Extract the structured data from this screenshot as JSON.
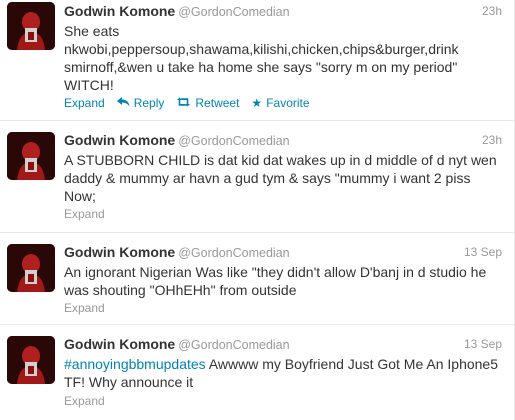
{
  "tweets": [
    {
      "name": "Godwin Komone",
      "handle": "@GordonComedian",
      "time": "23h",
      "text_plain": "She eats\nnkwobi,peppersoup,shawama,kilishi,chicken,chips&burger,drink\nsmirnoff,&wen u take ha home she says \"sorry m on my period\"\nWITCH!",
      "actions": {
        "expand": "Expand",
        "reply": "Reply",
        "retweet": "Retweet",
        "favorite": "Favorite"
      }
    },
    {
      "name": "Godwin Komone",
      "handle": "@GordonComedian",
      "time": "23h",
      "text_plain": "A STUBBORN CHILD is dat kid dat wakes up in d middle of d nyt wen\ndaddy & mummy ar havn a gud tym & says \"mummy i want 2 piss\nNow;",
      "actions": {
        "expand": "Expand"
      }
    },
    {
      "name": "Godwin Komone",
      "handle": "@GordonComedian",
      "time": "13 Sep",
      "text_plain": "An ignorant Nigerian Was like \"they didn't allow D'banj in d studio he\nwas shouting \"OHhEHh\" from outside",
      "actions": {
        "expand": "Expand"
      }
    },
    {
      "name": "Godwin Komone",
      "handle": "@GordonComedian",
      "time": "13 Sep",
      "hashtag": "#annoyingbbmupdates",
      "text_after_hashtag": " Awwww my Boyfriend Just Got Me An Iphone5\nTF! Why announce it",
      "actions": {
        "expand": "Expand"
      }
    }
  ],
  "colors": {
    "link": "#0084b4",
    "muted": "#999999",
    "text": "#333333",
    "divider": "#e8e8e8"
  },
  "icons": {
    "reply": "reply-arrow-icon",
    "retweet": "retweet-icon",
    "favorite": "star-icon"
  }
}
